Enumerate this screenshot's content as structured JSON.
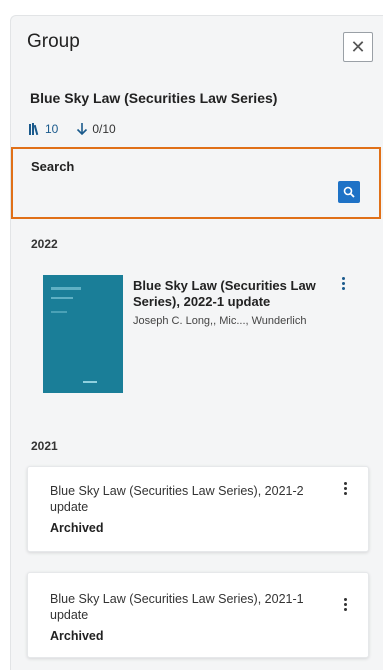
{
  "panel": {
    "title": "Group",
    "close_icon": "close-icon",
    "group_name": "Blue Sky Law (Securities Law Series)",
    "stats": {
      "volumes": "10",
      "downloads": "0/10"
    },
    "search": {
      "label": "Search",
      "placeholder": "",
      "value": ""
    }
  },
  "sections": [
    {
      "year": "2022",
      "items": [
        {
          "title": "Blue Sky Law (Securities Law Series), 2022-1 update",
          "authors": "Joseph C. Long,, Mic..., Wunderlich"
        }
      ]
    },
    {
      "year": "2021",
      "items": [
        {
          "title": "Blue Sky Law (Securities Law Series), 2021-2 update",
          "status": "Archived"
        },
        {
          "title": "Blue Sky Law (Securities Law Series), 2021-1 update",
          "status": "Archived"
        }
      ]
    }
  ],
  "colors": {
    "accent": "#1e72c6",
    "focus_outline": "#e07018",
    "cover": "#1a7e98"
  }
}
